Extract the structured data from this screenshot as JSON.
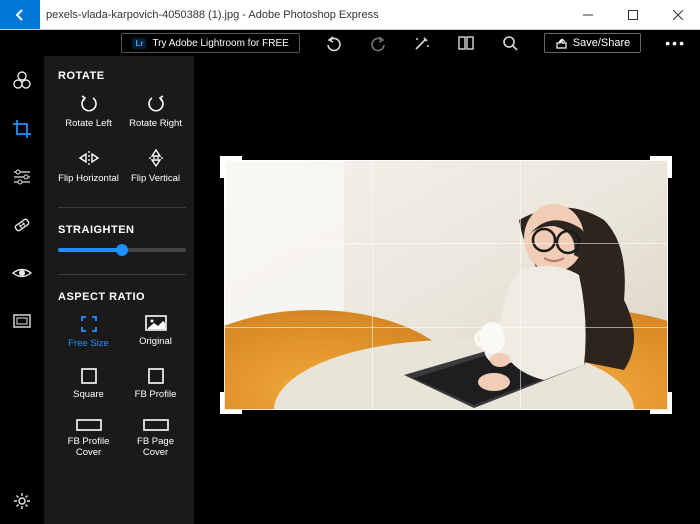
{
  "title": "pexels-vlada-karpovich-4050388 (1).jpg - Adobe Photoshop Express",
  "toolbar": {
    "promo": {
      "icon_label": "Lr",
      "text": "Try Adobe Lightroom for FREE"
    },
    "save_share": "Save/Share"
  },
  "rail": {
    "items": [
      "adjust",
      "crop",
      "sliders",
      "heal",
      "redeye",
      "border"
    ],
    "active": "crop"
  },
  "panel": {
    "rotate": {
      "heading": "ROTATE",
      "items": [
        {
          "icon": "rotate-left",
          "label": "Rotate Left"
        },
        {
          "icon": "rotate-right",
          "label": "Rotate Right"
        },
        {
          "icon": "flip-h",
          "label": "Flip Horizontal"
        },
        {
          "icon": "flip-v",
          "label": "Flip Vertical"
        }
      ]
    },
    "straighten": {
      "heading": "STRAIGHTEN",
      "value_pct": 50
    },
    "aspect": {
      "heading": "ASPECT RATIO",
      "items": [
        {
          "key": "free",
          "label": "Free Size",
          "selected": true
        },
        {
          "key": "original",
          "label": "Original"
        },
        {
          "key": "square",
          "label": "Square"
        },
        {
          "key": "fbprofile",
          "label": "FB Profile"
        },
        {
          "key": "fbprofilecover",
          "label": "FB Profile Cover"
        },
        {
          "key": "fbpagecover",
          "label": "FB Page Cover"
        }
      ]
    }
  }
}
